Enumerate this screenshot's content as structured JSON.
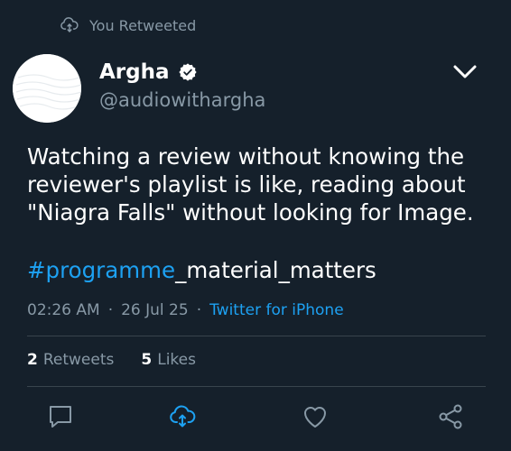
{
  "retweet_header": {
    "text": "You Retweeted",
    "icon": "retweet-cloud-icon"
  },
  "author": {
    "name": "Argha",
    "handle": "@audiowithargha",
    "verified_icon": "verified-badge-icon"
  },
  "tweet": {
    "lines": [
      "Watching a review without knowing the",
      "reviewer's playlist is like, reading about",
      "\"Niagra Falls\" without looking for Image."
    ],
    "hashtag": "#programme",
    "hashtag_suffix": "_material_matters"
  },
  "meta": {
    "time": "02:26 AM",
    "date": "26 Jul 25",
    "separator": "·",
    "source": "Twitter for iPhone"
  },
  "stats": {
    "retweets_count": "2",
    "retweets_label": "Retweets",
    "likes_count": "5",
    "likes_label": "Likes"
  },
  "actions": [
    "reply-icon",
    "retweet-icon",
    "like-icon",
    "share-icon"
  ],
  "colors": {
    "background": "#15202b",
    "accent": "#1da1f2",
    "muted": "#8899a6",
    "divider": "#38444d"
  }
}
